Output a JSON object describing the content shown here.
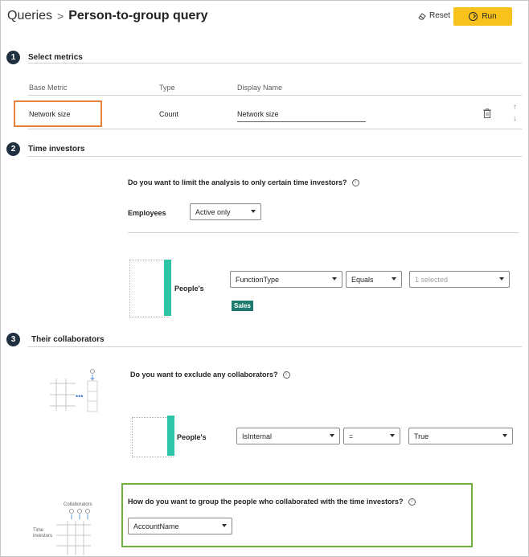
{
  "header": {
    "breadcrumb_root": "Queries",
    "separator": ">",
    "title": "Person-to-group query",
    "reset_label": "Reset",
    "run_label": "Run"
  },
  "section1": {
    "number": "1",
    "title": "Select metrics",
    "columns": [
      "Base Metric",
      "Type",
      "Display Name"
    ],
    "row": {
      "base_metric": "Network size",
      "type": "Count",
      "display_name": "Network size"
    }
  },
  "section2": {
    "number": "2",
    "title": "Time investors",
    "question": "Do you want to limit the analysis to only certain time investors?",
    "employees_label": "Employees",
    "employees_value": "Active only",
    "filter_label": "People's",
    "filter_attribute": "FunctionType",
    "filter_operator": "Equals",
    "filter_value": "1 selected",
    "selected_tag": "Sales"
  },
  "section3": {
    "number": "3",
    "title": "Their collaborators",
    "question": "Do you want to exclude any collaborators?",
    "filter_label": "People's",
    "filter_attribute": "IsInternal",
    "filter_operator": "=",
    "filter_value": "True",
    "group_question": "How do you want to group the people who collaborated with the time investors?",
    "group_value": "AccountName",
    "illus_collaborators": "Collaborators",
    "illus_time_investors": "Time investors"
  },
  "colors": {
    "run_button": "#f8c21d",
    "teal_bar": "#2ec4a8",
    "tag": "#1f7a6e",
    "highlight_orange": "#e8823a",
    "highlight_green": "#6fae3f"
  }
}
